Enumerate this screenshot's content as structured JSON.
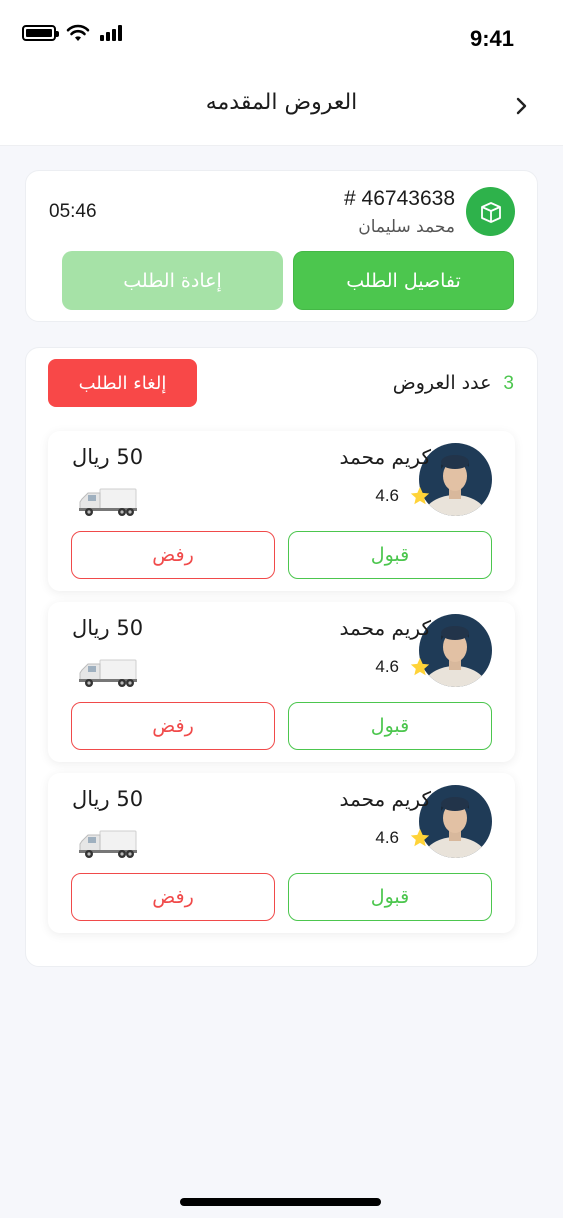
{
  "status_bar": {
    "time": "9:41"
  },
  "header": {
    "title": "العروض المقدمه",
    "back_icon": "chevron-right-icon"
  },
  "order": {
    "number": "# 46743638",
    "customer": "محمد سليمان",
    "time": "05:46",
    "icon": "package-icon",
    "details_label": "تفاصيل الطلب",
    "reorder_label": "إعادة الطلب"
  },
  "offers": {
    "label": "عدد العروض",
    "count": "3",
    "cancel_label": "إلغاء الطلب",
    "items": [
      {
        "driver_name": "كريم محمد",
        "rating": "4.6",
        "price": "50 ريال",
        "accept_label": "قبول",
        "reject_label": "رفض"
      },
      {
        "driver_name": "كريم محمد",
        "rating": "4.6",
        "price": "50 ريال",
        "accept_label": "قبول",
        "reject_label": "رفض"
      },
      {
        "driver_name": "كريم محمد",
        "rating": "4.6",
        "price": "50 ريال",
        "accept_label": "قبول",
        "reject_label": "رفض"
      }
    ]
  },
  "colors": {
    "accent_green": "#4cc64e",
    "danger_red": "#f84848",
    "disabled_green": "#a6e2a7",
    "background": "#f6f7fb"
  }
}
